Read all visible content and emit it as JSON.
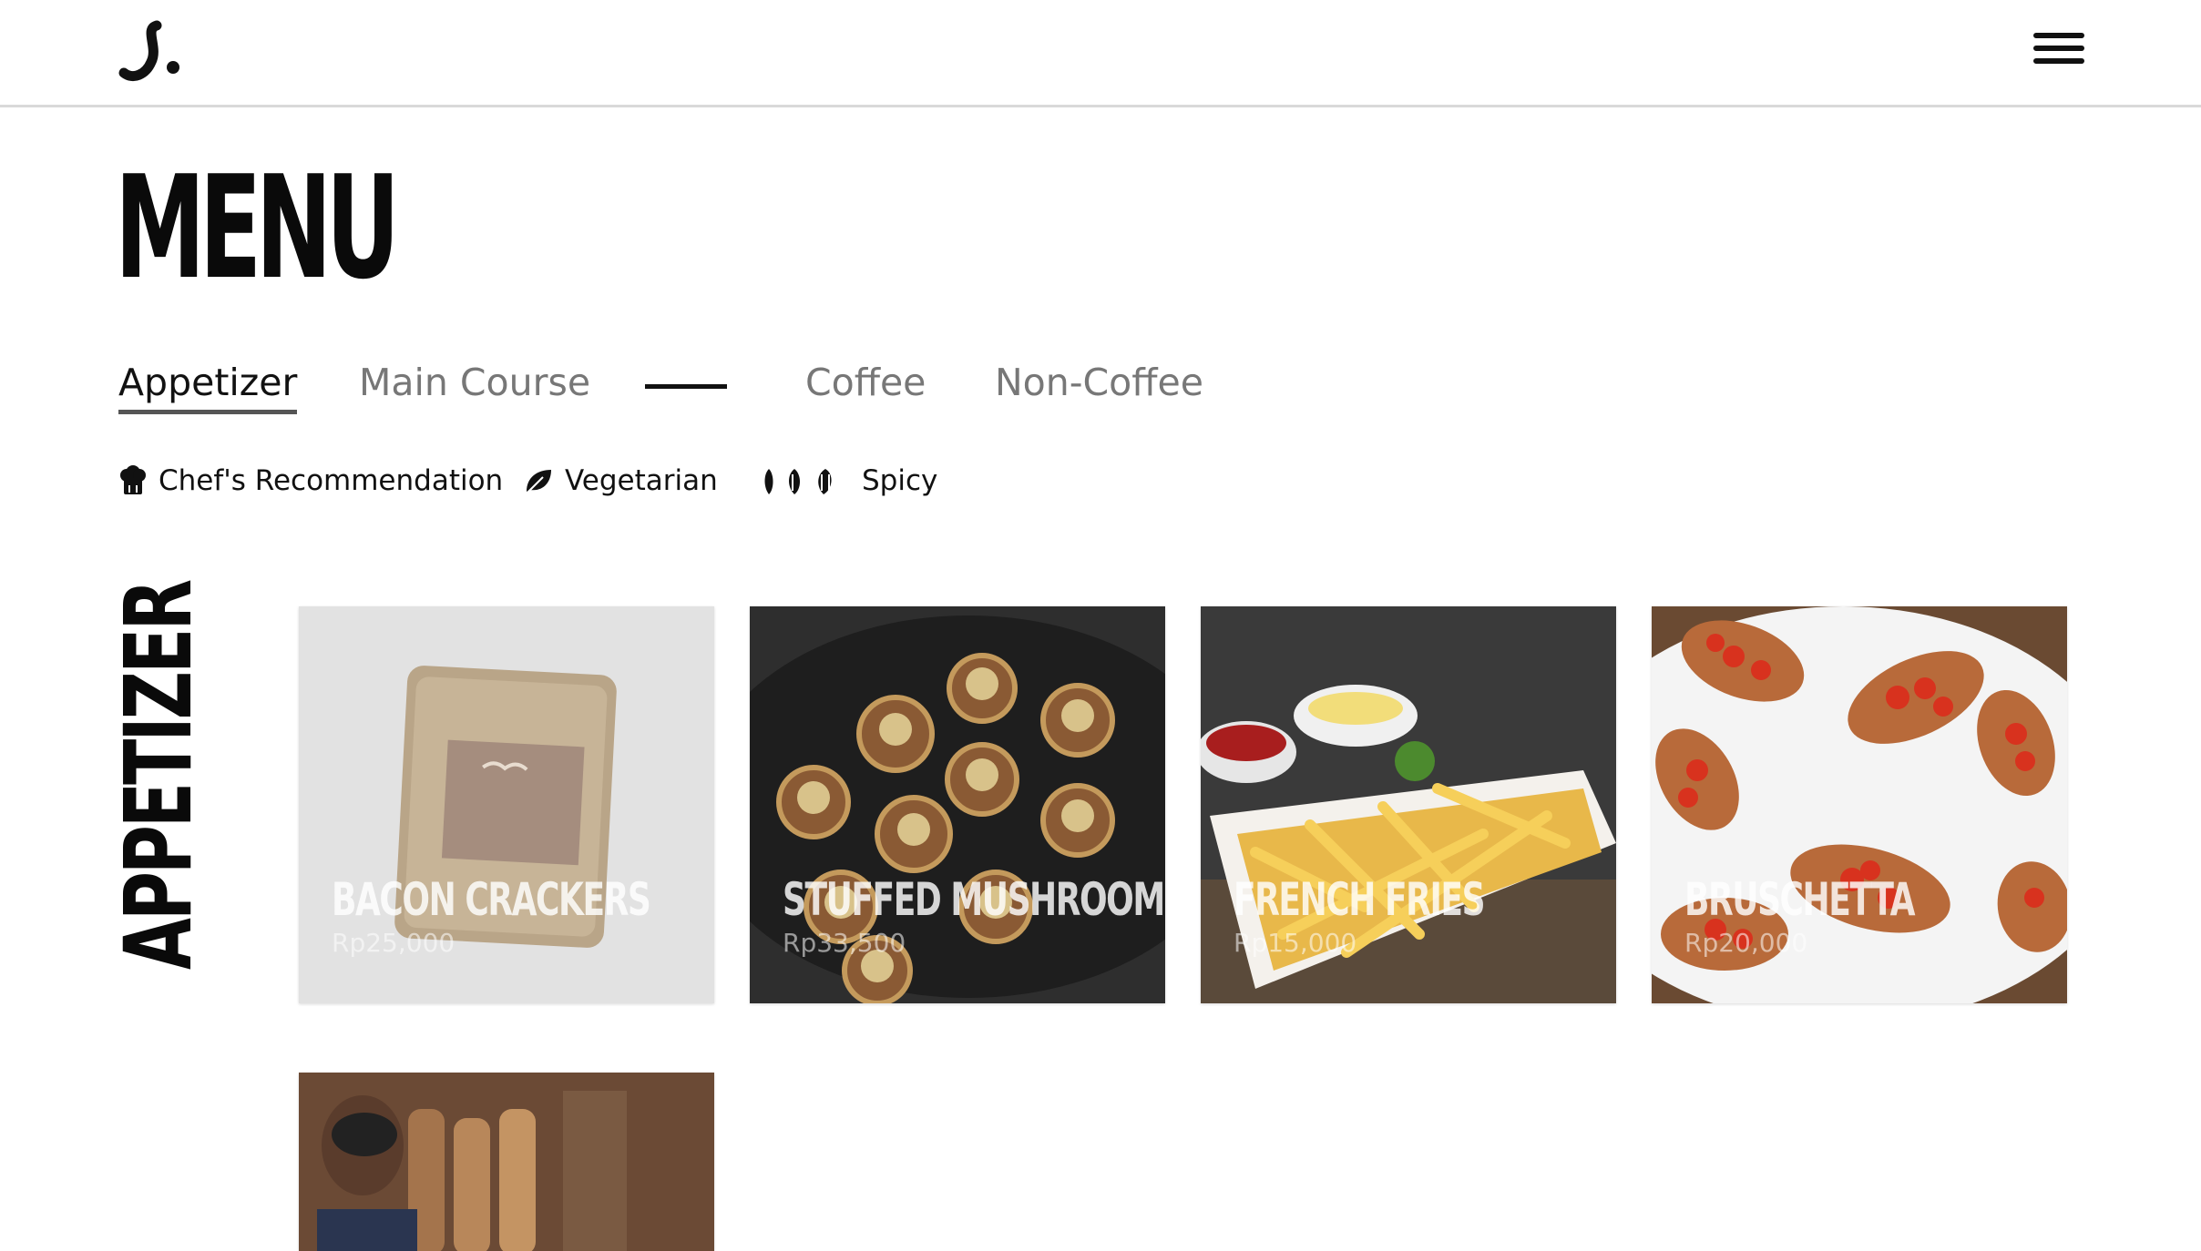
{
  "header": {
    "logo_icon": "brand-logo-icon",
    "menu_icon": "hamburger-menu-icon"
  },
  "page": {
    "title": "MENU"
  },
  "tabs": [
    {
      "label": "Appetizer",
      "active": true
    },
    {
      "label": "Main Course",
      "active": false
    },
    {
      "label": "Coffee",
      "active": false
    },
    {
      "label": "Non-Coffee",
      "active": false
    }
  ],
  "legend": {
    "chef": {
      "label": "Chef's Recommendation",
      "icon": "chef-hat-icon"
    },
    "vegetarian": {
      "label": "Vegetarian",
      "icon": "leaf-icon"
    },
    "spicy": {
      "label": "Spicy",
      "icon": "chili-icon"
    }
  },
  "section": {
    "label": "APPETIZER"
  },
  "items": [
    {
      "name": "BACON CRACKERS",
      "price": "Rp25,000"
    },
    {
      "name": "STUFFED MUSHROOMS",
      "price": "Rp33,500"
    },
    {
      "name": "FRENCH FRIES",
      "price": "Rp15,000"
    },
    {
      "name": "BRUSCHETTA",
      "price": "Rp20,000"
    }
  ],
  "colors": {
    "accent": "#111111",
    "muted_tab": "#777777",
    "divider": "#d9d9d9"
  }
}
